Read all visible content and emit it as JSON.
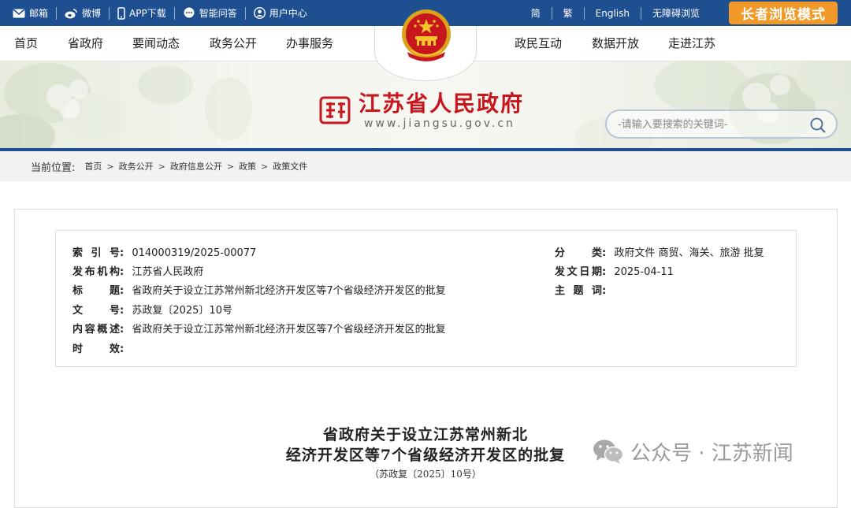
{
  "topbar": {
    "left": [
      {
        "label": "邮箱",
        "icon": "mail-icon"
      },
      {
        "label": "微博",
        "icon": "weibo-icon"
      },
      {
        "label": "APP下载",
        "icon": "phone-icon"
      },
      {
        "label": "智能问答",
        "icon": "chat-icon"
      },
      {
        "label": "用户中心",
        "icon": "user-icon"
      }
    ],
    "right": [
      "简",
      "繁",
      "English",
      "无障碍浏览"
    ],
    "elder_mode": "长者浏览模式",
    "bg_color": "#1e4f91",
    "elder_color": "#f29a29"
  },
  "nav": {
    "items": [
      "首页",
      "省政府",
      "要闻动态",
      "政务公开",
      "办事服务",
      "政民互动",
      "数据开放",
      "走进江苏"
    ]
  },
  "banner": {
    "site_title": "江苏省人民政府",
    "site_url": "www.jiangsu.gov.cn",
    "search_placeholder": "-请输入要搜索的关键词-"
  },
  "breadcrumb": {
    "label": "当前位置:",
    "items": [
      "首页",
      "政务公开",
      "政府信息公开",
      "政策",
      "政策文件"
    ]
  },
  "meta": {
    "index_no_label": "索引号:",
    "index_no": "014000319/2025-00077",
    "category_label": "分类:",
    "category": "政府文件 商贸、海关、旅游 批复",
    "issuer_label": "发布机构:",
    "issuer": "江苏省人民政府",
    "date_label": "发文日期:",
    "date": "2025-04-11",
    "title_label": "标题:",
    "title": "省政府关于设立江苏常州新北经济开发区等7个省级经济开发区的批复",
    "keywords_label": "主题词:",
    "keywords": "",
    "doc_no_label": "文号:",
    "doc_no": "苏政复〔2025〕10号",
    "summary_label": "内容概述:",
    "summary": "省政府关于设立江苏常州新北经济开发区等7个省级经济开发区的批复",
    "validity_label": "时效:",
    "validity": ""
  },
  "document": {
    "title_line1": "省政府关于设立江苏常州新北",
    "title_line2": "经济开发区等7个省级经济开发区的批复",
    "doc_number": "（苏政复〔2025〕10号）"
  },
  "watermark": {
    "text": "公众号 · 江苏新闻",
    "icon": "wechat-icon"
  }
}
